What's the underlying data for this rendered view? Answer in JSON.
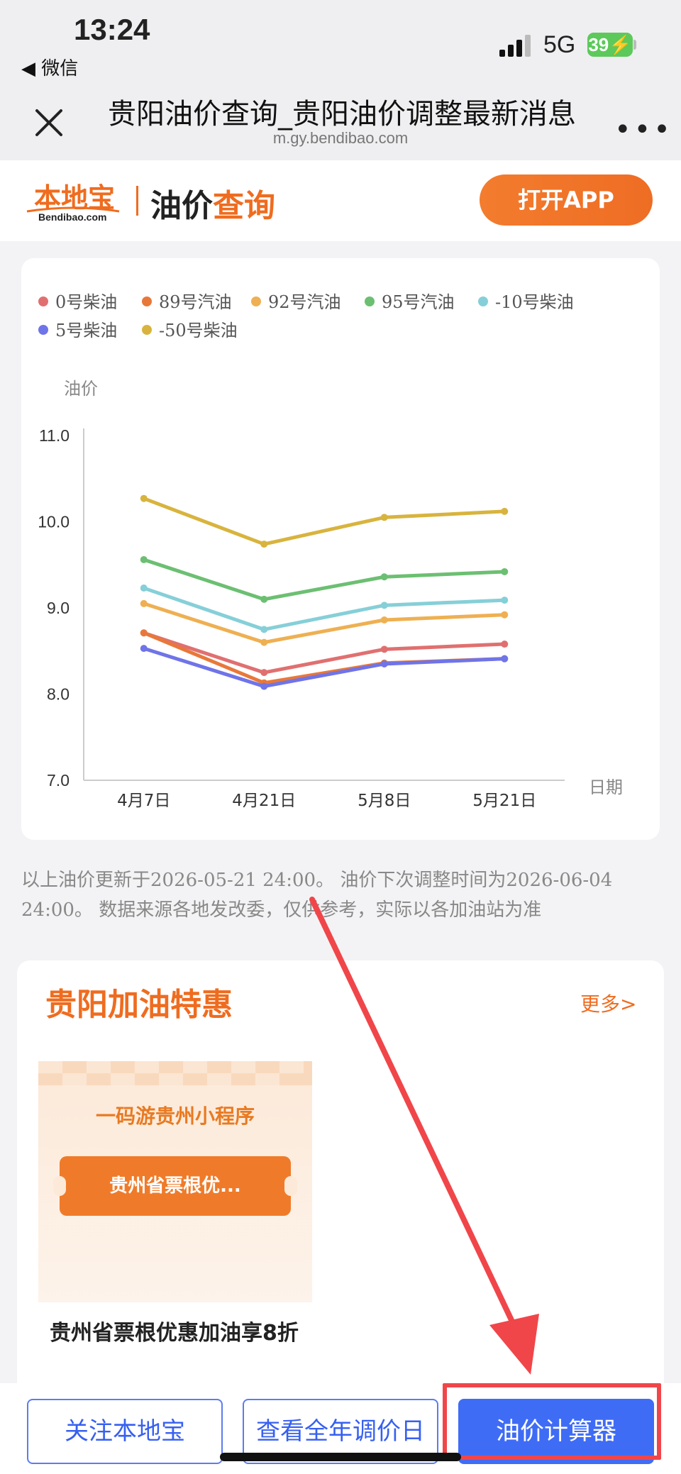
{
  "status": {
    "time": "13:24",
    "back_app": "◀ 微信",
    "network": "5G",
    "battery": "39"
  },
  "nav": {
    "title": "贵阳油价查询_贵阳油价调整最新消息",
    "url": "m.gy.bendibao.com"
  },
  "header": {
    "logo_cn": "本地宝",
    "logo_en": "Bendibao.com",
    "title_a": "油价",
    "title_b": "查询",
    "open_app": "打开APP"
  },
  "chart_data": {
    "type": "line",
    "ylabel": "油价",
    "xlabel": "日期",
    "ylim": [
      7.0,
      11.0
    ],
    "yticks": [
      "11.0",
      "10.0",
      "9.0",
      "8.0",
      "7.0"
    ],
    "categories": [
      "4月7日",
      "4月21日",
      "5月8日",
      "5月21日"
    ],
    "series": [
      {
        "name": "0号柴油",
        "color": "#e07070",
        "values": [
          8.71,
          8.25,
          8.52,
          8.58
        ]
      },
      {
        "name": "89号汽油",
        "color": "#e8783a",
        "values": [
          8.71,
          8.13,
          8.36,
          8.41
        ]
      },
      {
        "name": "92号汽油",
        "color": "#eeb052",
        "values": [
          9.05,
          8.6,
          8.86,
          8.92
        ]
      },
      {
        "name": "95号汽油",
        "color": "#6cbf72",
        "values": [
          9.56,
          9.1,
          9.36,
          9.42
        ]
      },
      {
        "name": "-10号柴油",
        "color": "#86cfd8",
        "values": [
          9.23,
          8.75,
          9.03,
          9.09
        ]
      },
      {
        "name": "5号柴油",
        "color": "#6f74e8",
        "values": [
          8.53,
          8.09,
          8.35,
          8.41
        ]
      },
      {
        "name": "-50号柴油",
        "color": "#d8b43e",
        "values": [
          10.27,
          9.74,
          10.05,
          10.12
        ]
      }
    ]
  },
  "note": "以上油价更新于2026-05-21 24:00。 油价下次调整时间为2026-06-04 24:00。 数据来源各地发改委，仅供参考，实际以各加油站为准",
  "promo": {
    "title": "贵阳加油特惠",
    "more": "更多>",
    "thumb_title": "一码游贵州小程序",
    "ticket": "贵州省票根优...",
    "caption": "贵州省票根优惠加油享8折"
  },
  "bottom": {
    "follow": "关注本地宝",
    "year": "查看全年调价日",
    "calc": "油价计算器"
  },
  "colors": {
    "accent": "#ef6c1f",
    "primary_blue": "#3f6cf5",
    "highlight_red": "#f0464a"
  }
}
